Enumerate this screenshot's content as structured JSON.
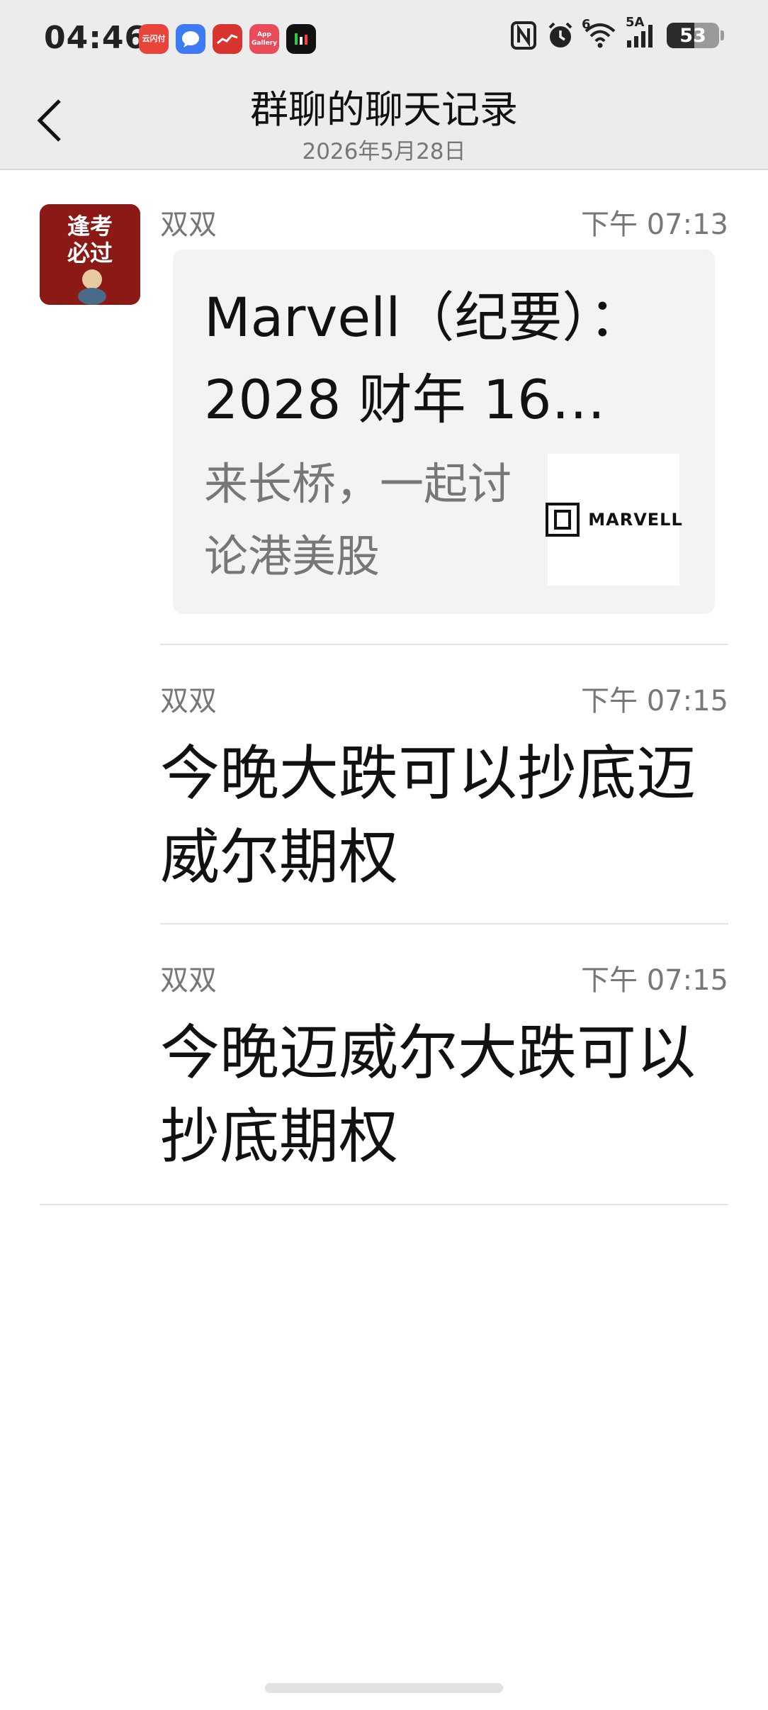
{
  "status_bar": {
    "time": "04:46",
    "notification_icons": [
      {
        "name": "cloud-pay-app-icon",
        "label": "云闪付"
      },
      {
        "name": "messages-app-icon",
        "label": ""
      },
      {
        "name": "stock-app-icon",
        "label": ""
      },
      {
        "name": "app-gallery-icon",
        "label": "App Gallery"
      },
      {
        "name": "stock-chart-app-icon",
        "label": ""
      }
    ],
    "network_label": "5A",
    "wifi_label": "6",
    "battery": "53",
    "battery_level_percent": 53
  },
  "header": {
    "title": "群聊的聊天记录",
    "subtitle": "2026年5月28日"
  },
  "messages": [
    {
      "sender": "双双",
      "time": "下午 07:13",
      "type": "link_card",
      "card": {
        "title": "Marvell（纪要）：2028 财年 16…",
        "description": "来长桥，一起讨论港美股",
        "thumbnail_text": "MARVELL"
      }
    },
    {
      "sender": "双双",
      "time": "下午 07:15",
      "type": "text",
      "text": "今晚大跌可以抄底迈威尔期权"
    },
    {
      "sender": "双双",
      "time": "下午 07:15",
      "type": "text",
      "text": "今晚迈威尔大跌可以抄底期权"
    }
  ],
  "avatar": {
    "text_line1": "逢考",
    "text_line2": "必过"
  },
  "colors": {
    "header_bg": "#ececec",
    "card_bg": "#f3f3f3",
    "meta_text": "#777777",
    "avatar_bg": "#8b1a16"
  }
}
